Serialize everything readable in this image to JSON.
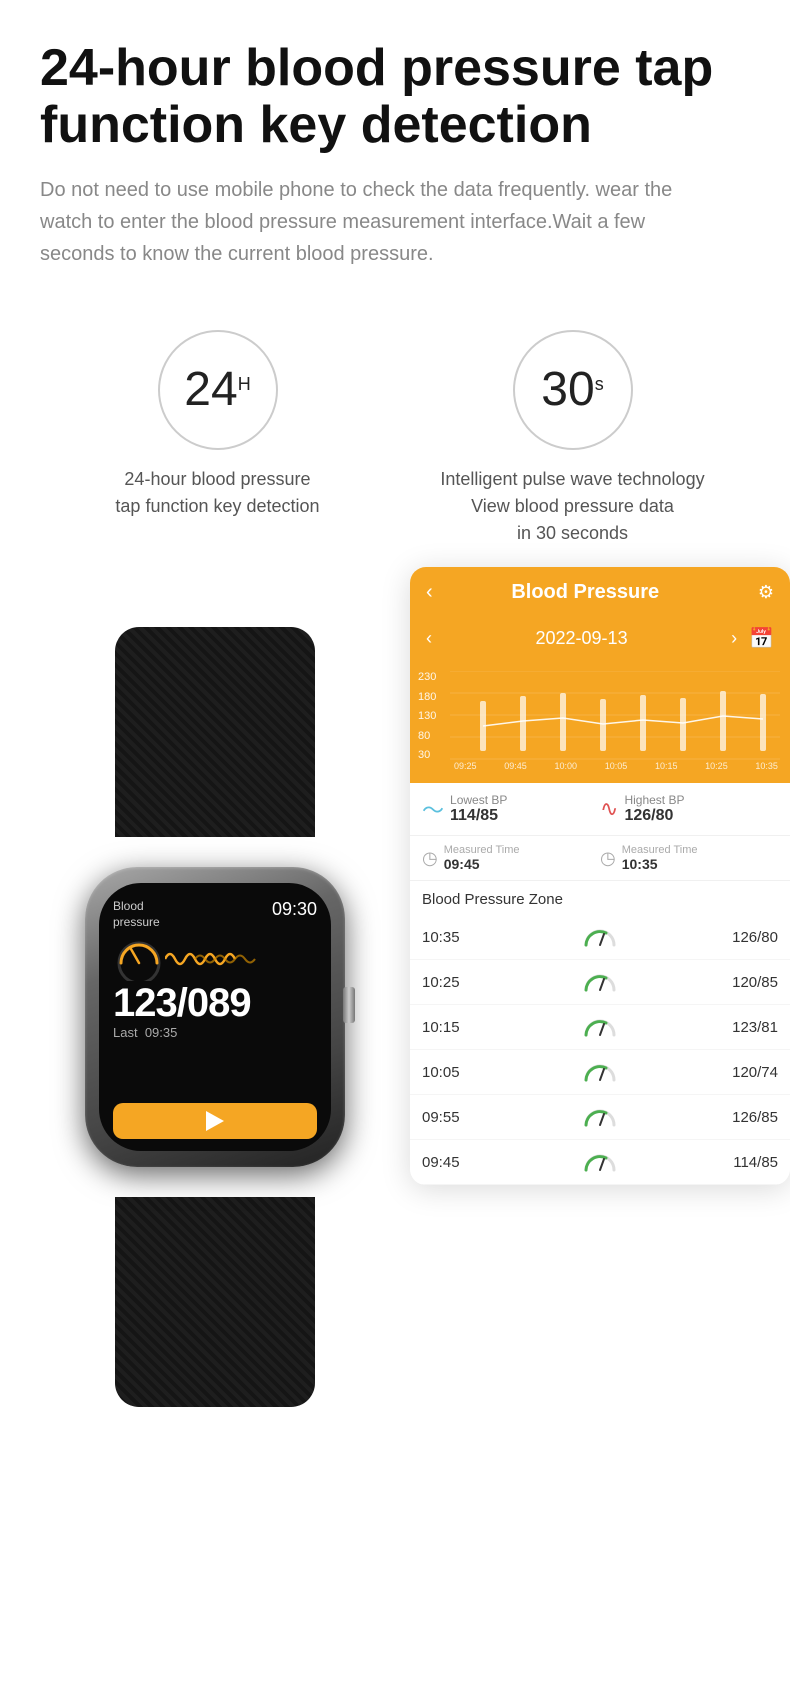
{
  "header": {
    "main_title": "24-hour blood pressure tap function key detection",
    "subtitle": "Do not need to use mobile phone to check the data frequently. wear the watch to enter the blood pressure measurement interface.Wait a few seconds to know the current blood pressure."
  },
  "icons": [
    {
      "number": "24",
      "unit": "H",
      "label": "24-hour blood pressure\ntap function key detection"
    },
    {
      "number": "30",
      "unit": "s",
      "label": "Intelligent pulse wave technology\nView blood pressure data\nin 30 seconds"
    }
  ],
  "watch": {
    "bp_label_line1": "Blood",
    "bp_label_line2": "pressure",
    "time": "09:30",
    "reading": "123/089",
    "last_label": "Last",
    "last_time": "09:35"
  },
  "app": {
    "back_icon": "‹",
    "title": "Blood Pressure",
    "settings_icon": "⚙",
    "date_prev": "‹",
    "date": "2022-09-13",
    "date_next": "›",
    "cal_icon": "📅",
    "chart_y_labels": [
      "230",
      "180",
      "130",
      "80",
      "30"
    ],
    "chart_x_labels": [
      "09:25",
      "09:45",
      "10:00",
      "10:05",
      "10:15",
      "10:25",
      "10:35"
    ],
    "lowest_bp_label": "Lowest BP",
    "lowest_bp_value": "114/85",
    "highest_bp_label": "Highest BP",
    "highest_bp_value": "126/80",
    "measured_time_label_1": "Measured Time",
    "measured_time_value_1": "09:45",
    "measured_time_label_2": "Measured Time",
    "measured_time_value_2": "10:35",
    "zone_header": "Blood Pressure Zone",
    "bp_rows": [
      {
        "time": "10:35",
        "value": "126/80"
      },
      {
        "time": "10:25",
        "value": "120/85"
      },
      {
        "time": "10:15",
        "value": "123/81"
      },
      {
        "time": "10:05",
        "value": "120/74"
      },
      {
        "time": "09:55",
        "value": "126/85"
      },
      {
        "time": "09:45",
        "value": "114/85"
      }
    ]
  },
  "colors": {
    "orange": "#f5a623",
    "dark": "#1a1a1a",
    "gray_text": "#888888"
  }
}
